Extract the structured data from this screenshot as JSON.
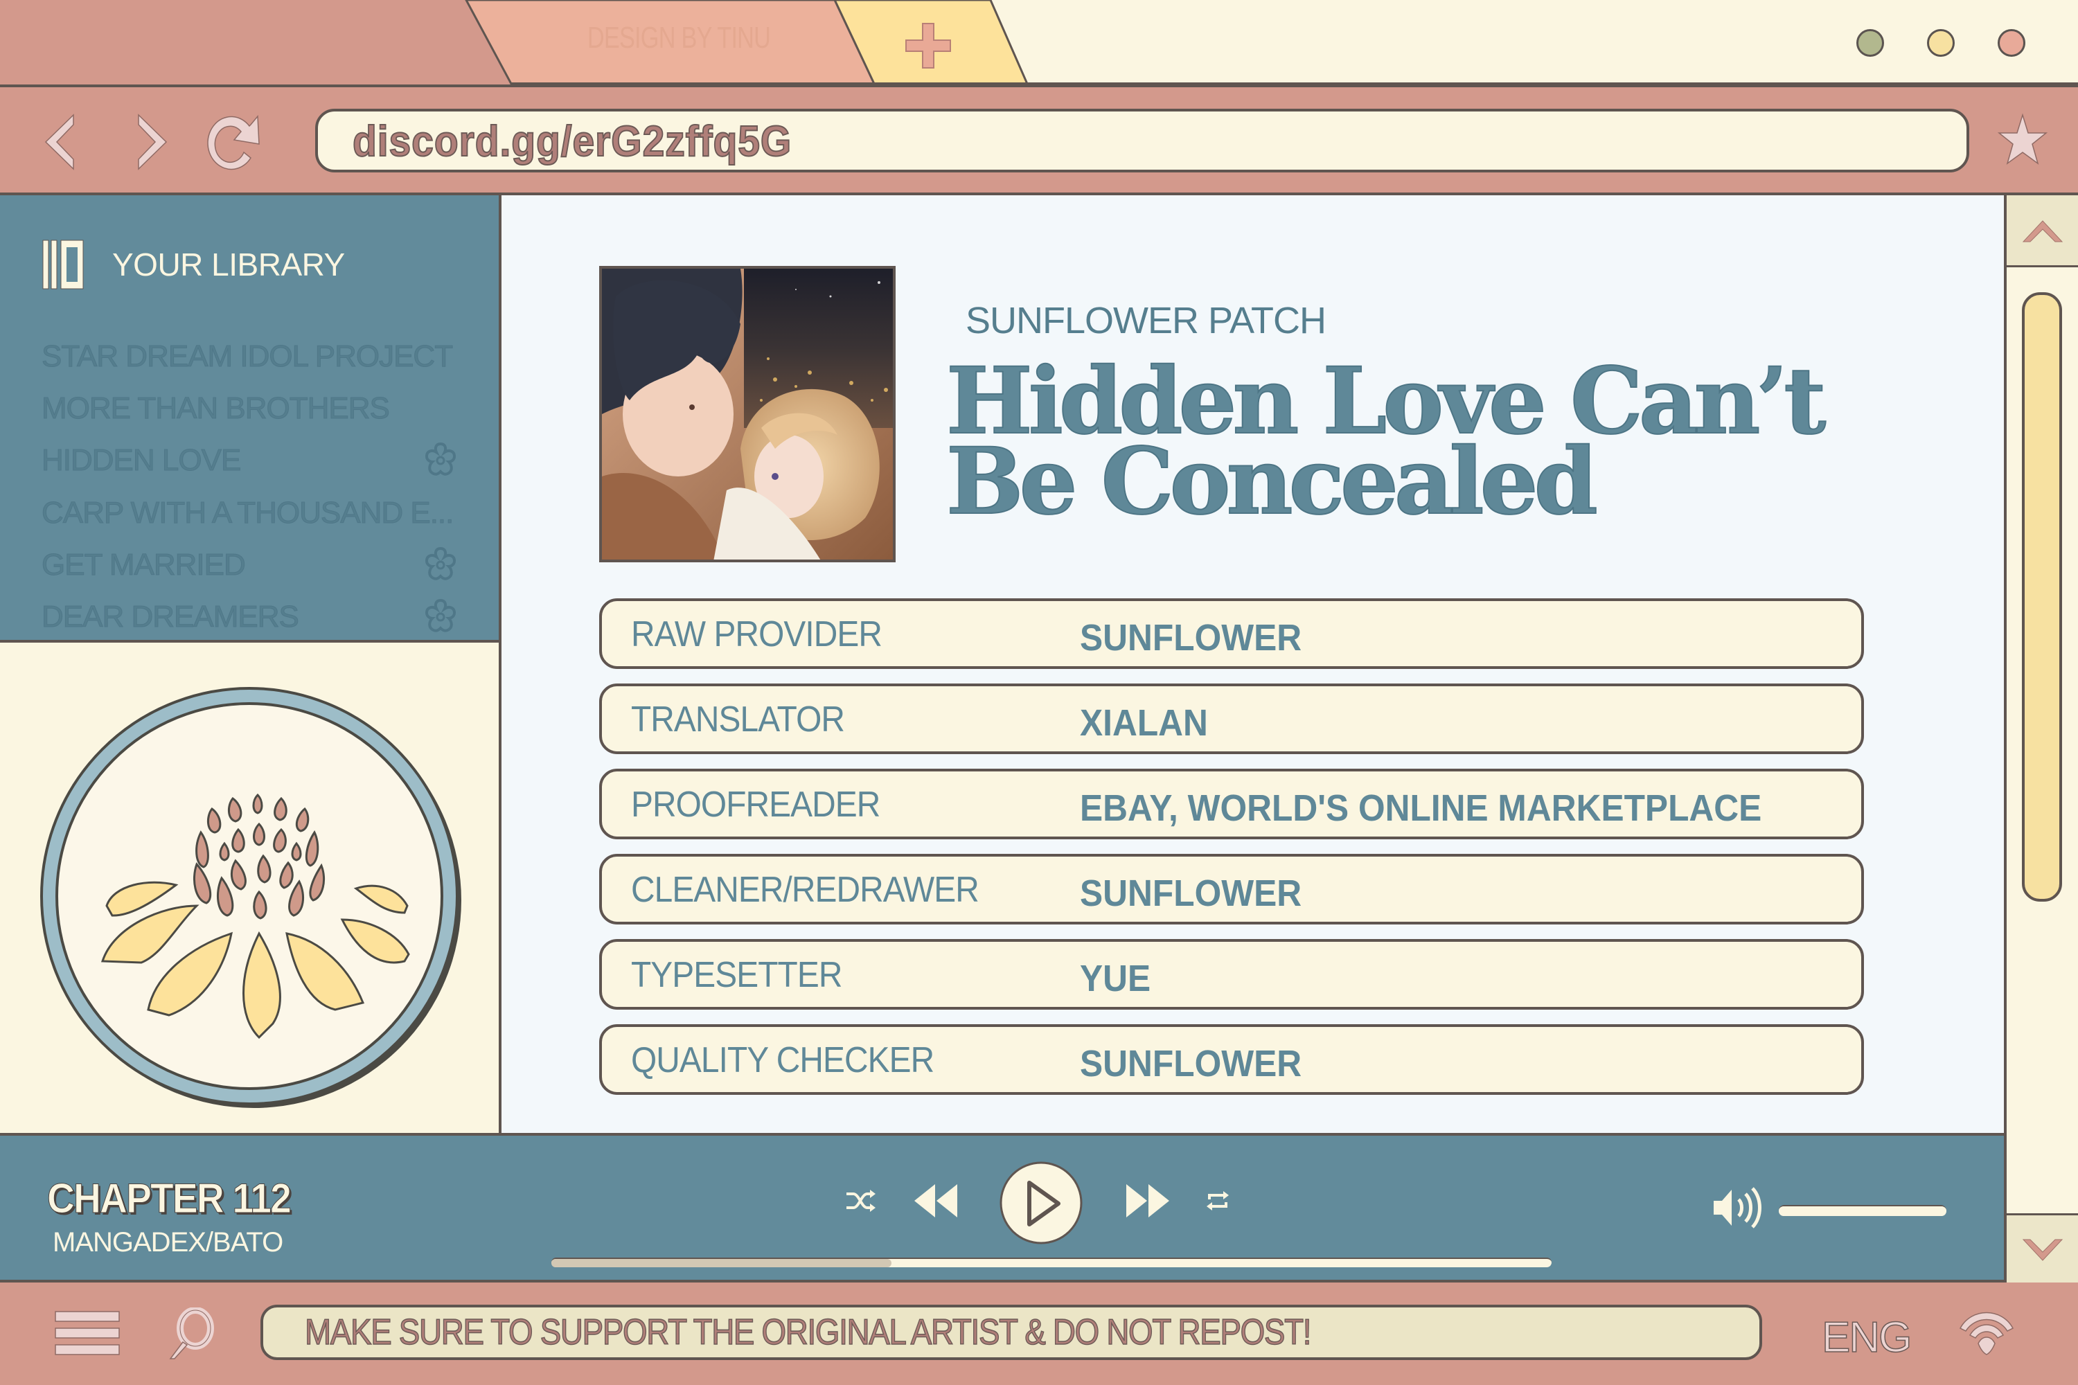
{
  "browser": {
    "tabs": [
      {
        "label": "DESIGN BY TINU",
        "active": true
      },
      {
        "label": "+",
        "icon": "plus-icon"
      }
    ],
    "window_controls": [
      {
        "name": "minimize",
        "color": "#b2b88e"
      },
      {
        "name": "maximize",
        "color": "#f7e1a1"
      },
      {
        "name": "close",
        "color": "#e8aa99"
      }
    ],
    "nav": {
      "back_icon": "chevron-left-icon",
      "forward_icon": "chevron-right-icon",
      "reload_icon": "reload-icon"
    },
    "url": "discord.gg/erG2zffq5G",
    "bookmark_icon": "star-icon"
  },
  "sidebar": {
    "header": {
      "icon": "library-icon",
      "title": "YOUR LIBRARY"
    },
    "items": [
      {
        "label": "STAR DREAM IDOL PROJECT",
        "badge": false
      },
      {
        "label": "MORE THAN BROTHERS",
        "badge": false
      },
      {
        "label": "HIDDEN LOVE",
        "badge": true
      },
      {
        "label": "CARP WITH A THOUSAND E...",
        "badge": false
      },
      {
        "label": "GET MARRIED",
        "badge": true
      },
      {
        "label": "DEAR DREAMERS",
        "badge": true
      }
    ],
    "logo": "sunflower-emblem"
  },
  "main": {
    "group_name": "SUNFLOWER PATCH",
    "title_line1": "Hidden Love Can’t",
    "title_line2": "Be Concealed",
    "credits": [
      {
        "role": "RAW PROVIDER",
        "name": "SUNFLOWER"
      },
      {
        "role": "TRANSLATOR",
        "name": "XIALAN"
      },
      {
        "role": "PROOFREADER",
        "name": "EBAY, WORLD'S ONLINE MARKETPLACE"
      },
      {
        "role": "CLEANER/REDRAWER",
        "name": "SUNFLOWER"
      },
      {
        "role": "TYPESETTER",
        "name": "YUE"
      },
      {
        "role": "QUALITY CHECKER",
        "name": "SUNFLOWER"
      }
    ]
  },
  "player": {
    "chapter": "CHAPTER 112",
    "source": "MANGADEX/BATO",
    "controls": [
      "shuffle-icon",
      "rewind-icon",
      "play-icon",
      "fast-forward-icon",
      "repeat-icon"
    ],
    "progress": 0.34,
    "volume": 1.0,
    "volume_icon": "speaker-icon"
  },
  "bottom_bar": {
    "menu_icon": "hamburger-menu-icon",
    "search_icon": "search-icon",
    "notice": "MAKE SURE TO SUPPORT THE ORIGINAL ARTIST & DO NOT REPOST!",
    "language": "ENG",
    "wifi_icon": "wifi-icon"
  },
  "scrollbar": {
    "position": 0.0,
    "up_icon": "chevron-up-icon",
    "down_icon": "chevron-down-icon"
  },
  "colors": {
    "frame_pink": "#d3998c",
    "cream": "#fbf6e1",
    "teal": "#628b9b",
    "title_teal": "#5f8898",
    "butter": "#f7e1a1",
    "outline": "#5f5550"
  }
}
